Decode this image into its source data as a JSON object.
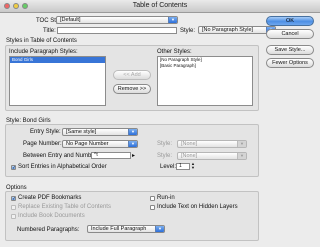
{
  "window": {
    "title": "Table of Contents"
  },
  "toc_style": {
    "label": "TOC Style:",
    "value": "[Default]"
  },
  "title_row": {
    "label": "Title:",
    "value": "",
    "style_label": "Style:",
    "style_value": "[No Paragraph Style]"
  },
  "styles_section": {
    "heading": "Styles in Table of Contents",
    "include_label": "Include Paragraph Styles:",
    "include_items": [
      "Bond Girls"
    ],
    "add_button": "<< Add",
    "remove_button": "Remove >>",
    "other_label": "Other Styles:",
    "other_items": [
      "[No Paragraph Style]",
      "[Basic Paragraph]"
    ]
  },
  "style_section": {
    "heading": "Style: Bond Girls",
    "entry_label": "Entry Style:",
    "entry_value": "[Same style]",
    "page_number_label": "Page Number:",
    "page_number_value": "No Page Number",
    "page_style_label": "Style:",
    "page_style_value": "[None]",
    "between_label": "Between Entry and Number:",
    "between_value": "^t",
    "between_style_label": "Style:",
    "between_style_value": "[None]",
    "sort_label": "Sort Entries in Alphabetical Order",
    "sort_checked": true,
    "level_label": "Level:",
    "level_value": "1"
  },
  "options_section": {
    "heading": "Options",
    "create_pdf": "Create PDF Bookmarks",
    "create_pdf_checked": true,
    "replace_existing": "Replace Existing Table of Contents",
    "include_book": "Include Book Documents",
    "run_in": "Run-in",
    "include_hidden": "Include Text on Hidden Layers",
    "numbered_label": "Numbered Paragraphs:",
    "numbered_value": "Include Full Paragraph"
  },
  "buttons": {
    "ok": "OK",
    "cancel": "Cancel",
    "save_style": "Save Style...",
    "fewer_options": "Fewer Options"
  },
  "colors": {
    "accent": "#3875d7",
    "default_button": "#4d8fe4"
  }
}
